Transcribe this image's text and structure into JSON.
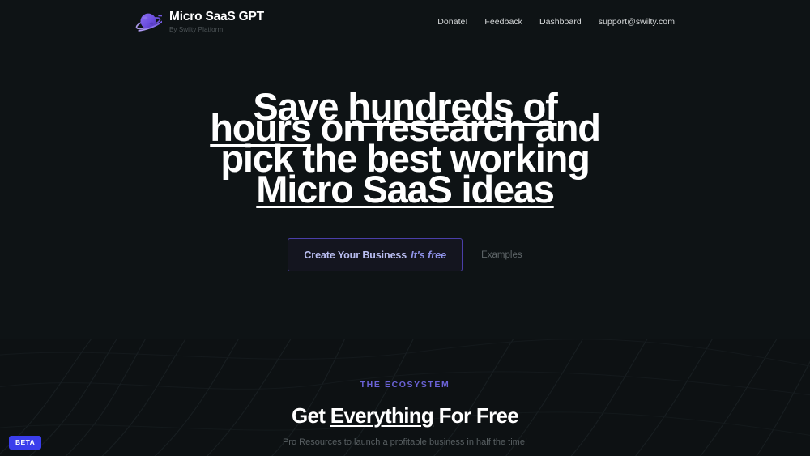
{
  "colors": {
    "page_bg": "#0e1315",
    "section_bg": "#0d1113",
    "accent_purple": "#6a62d6",
    "button_border": "#4a3fa8",
    "button_text": "#b9bdf0",
    "beta_badge_bg": "#3b3eec",
    "heading_white": "#ffffff",
    "muted_text": "#585f62"
  },
  "header": {
    "logo_icon": "planet-saturn-icon",
    "brand_title": "Micro SaaS GPT",
    "brand_subtitle": "By Swilty Platform",
    "nav": [
      {
        "label": "Donate!"
      },
      {
        "label": "Feedback"
      },
      {
        "label": "Dashboard"
      },
      {
        "label": "support@swilty.com"
      }
    ]
  },
  "hero": {
    "headline_lines": [
      {
        "plain_before": "Save ",
        "underlined": "hundreds of",
        "plain_after": ""
      },
      {
        "plain_before": "",
        "underlined": "hours",
        "plain_after": " on research and"
      },
      {
        "plain_before": "pick the best working",
        "underlined": "",
        "plain_after": ""
      },
      {
        "plain_before": "",
        "underlined": "Micro SaaS ideas",
        "plain_after": ""
      }
    ],
    "cta": {
      "label": "Create Your Business",
      "free_label": "It's free"
    },
    "secondary_link": "Examples"
  },
  "ecosystem": {
    "eyebrow": "THE ECOSYSTEM",
    "title_before": "Get ",
    "title_underlined": "Everything",
    "title_after": " For Free",
    "subtitle": "Pro Resources to launch a profitable business in half the time!"
  },
  "beta_badge": {
    "label": "BETA"
  }
}
